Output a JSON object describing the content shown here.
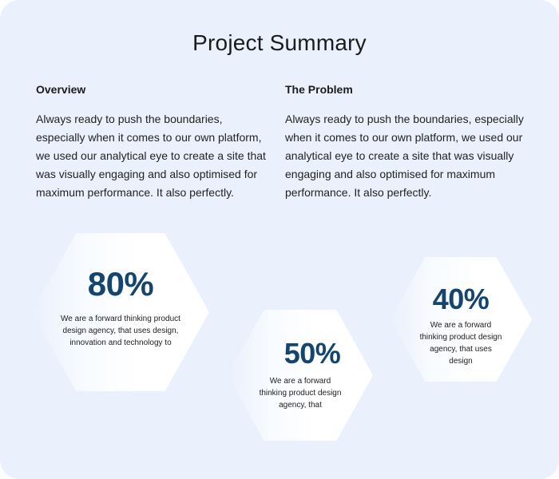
{
  "title": "Project Summary",
  "overview": {
    "heading": "Overview",
    "text": "Always ready to push the boundaries, especially when it comes to our own platform, we used our analytical eye to create a site that was visually engaging and also optimised for maximum performance. It also perfectly."
  },
  "problem": {
    "heading": "The Problem",
    "text": "Always ready to push the boundaries, especially when it comes to our own platform, we used our analytical eye to create a site that was visually engaging and also optimised for maximum performance. It also perfectly."
  },
  "stats": [
    {
      "value": "80%",
      "text": "We are a forward thinking product design agency, that uses design, innovation and technology to"
    },
    {
      "value": "50%",
      "text": "We are a forward thinking product design agency, that"
    },
    {
      "value": "40%",
      "text": "We are a forward thinking product design agency, that uses design"
    }
  ],
  "colors": {
    "background": "#eaf1fc",
    "accent": "#14456f",
    "hexagon": "#ffffff"
  }
}
